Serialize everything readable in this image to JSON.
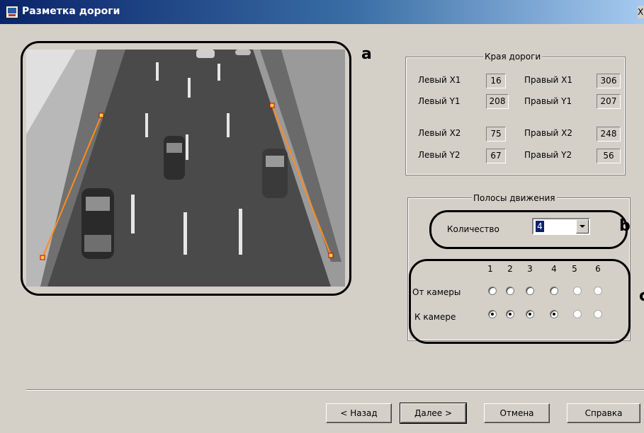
{
  "window": {
    "title": "Разметка дороги",
    "close_label": "X"
  },
  "callouts": {
    "a": "a",
    "b": "b",
    "c": "c"
  },
  "road_edges": {
    "title": "Края дороги",
    "left_x1_label": "Левый X1",
    "left_x1": "16",
    "right_x1_label": "Правый X1",
    "right_x1": "306",
    "left_y1_label": "Левый Y1",
    "left_y1": "208",
    "right_y1_label": "Правый Y1",
    "right_y1": "207",
    "left_x2_label": "Левый X2",
    "left_x2": "75",
    "right_x2_label": "Правый X2",
    "right_x2": "248",
    "left_y2_label": "Левый Y2",
    "left_y2": "67",
    "right_y2_label": "Правый Y2",
    "right_y2": "56"
  },
  "lanes": {
    "title": "Полосы движения",
    "count_label": "Количество",
    "count_value": "4",
    "columns": [
      "1",
      "2",
      "3",
      "4",
      "5",
      "6"
    ],
    "from_camera_label": "От камеры",
    "to_camera_label": "К камере",
    "from_camera_states": [
      "off",
      "off",
      "off",
      "off",
      "disabled",
      "disabled"
    ],
    "to_camera_states": [
      "on",
      "on",
      "on",
      "on",
      "disabled",
      "disabled"
    ]
  },
  "buttons": {
    "back": "< Назад",
    "next": "Далее >",
    "cancel": "Отмена",
    "help": "Справка"
  },
  "colors": {
    "road_edge_line": "#ff8c1a",
    "title_bar": "#0a246a"
  }
}
